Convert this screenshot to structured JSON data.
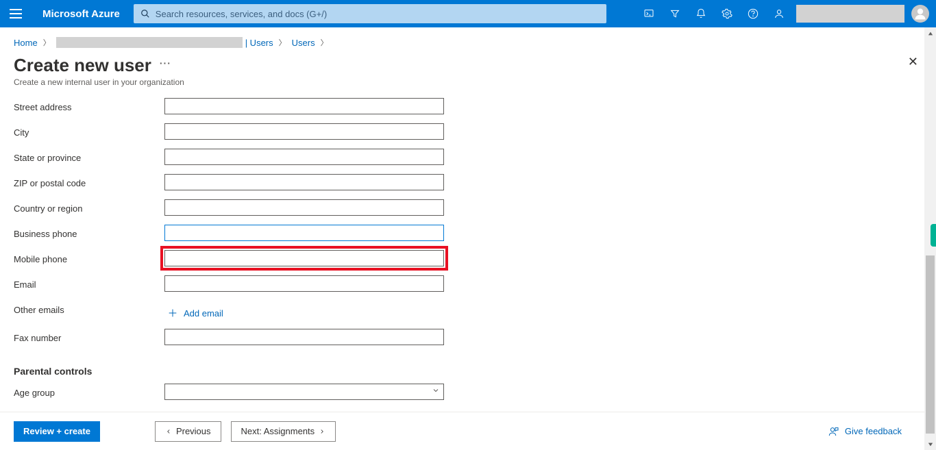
{
  "header": {
    "brand": "Microsoft Azure",
    "search_placeholder": "Search resources, services, and docs (G+/)"
  },
  "breadcrumb": {
    "home": "Home",
    "item2_suffix": "| Users",
    "item3": "Users"
  },
  "page": {
    "title": "Create new user",
    "subtitle": "Create a new internal user in your organization"
  },
  "form": {
    "street_label": "Street address",
    "street_value": "",
    "city_label": "City",
    "city_value": "",
    "state_label": "State or province",
    "state_value": "",
    "zip_label": "ZIP or postal code",
    "zip_value": "",
    "country_label": "Country or region",
    "country_value": "",
    "businessphone_label": "Business phone",
    "businessphone_value": "",
    "mobile_label": "Mobile phone",
    "mobile_value": "",
    "email_label": "Email",
    "email_value": "",
    "otheremails_label": "Other emails",
    "add_email_label": "Add email",
    "fax_label": "Fax number",
    "fax_value": "",
    "parental_section": "Parental controls",
    "agegroup_label": "Age group",
    "agegroup_value": ""
  },
  "footer": {
    "review": "Review + create",
    "previous": "Previous",
    "next": "Next: Assignments",
    "feedback": "Give feedback"
  }
}
